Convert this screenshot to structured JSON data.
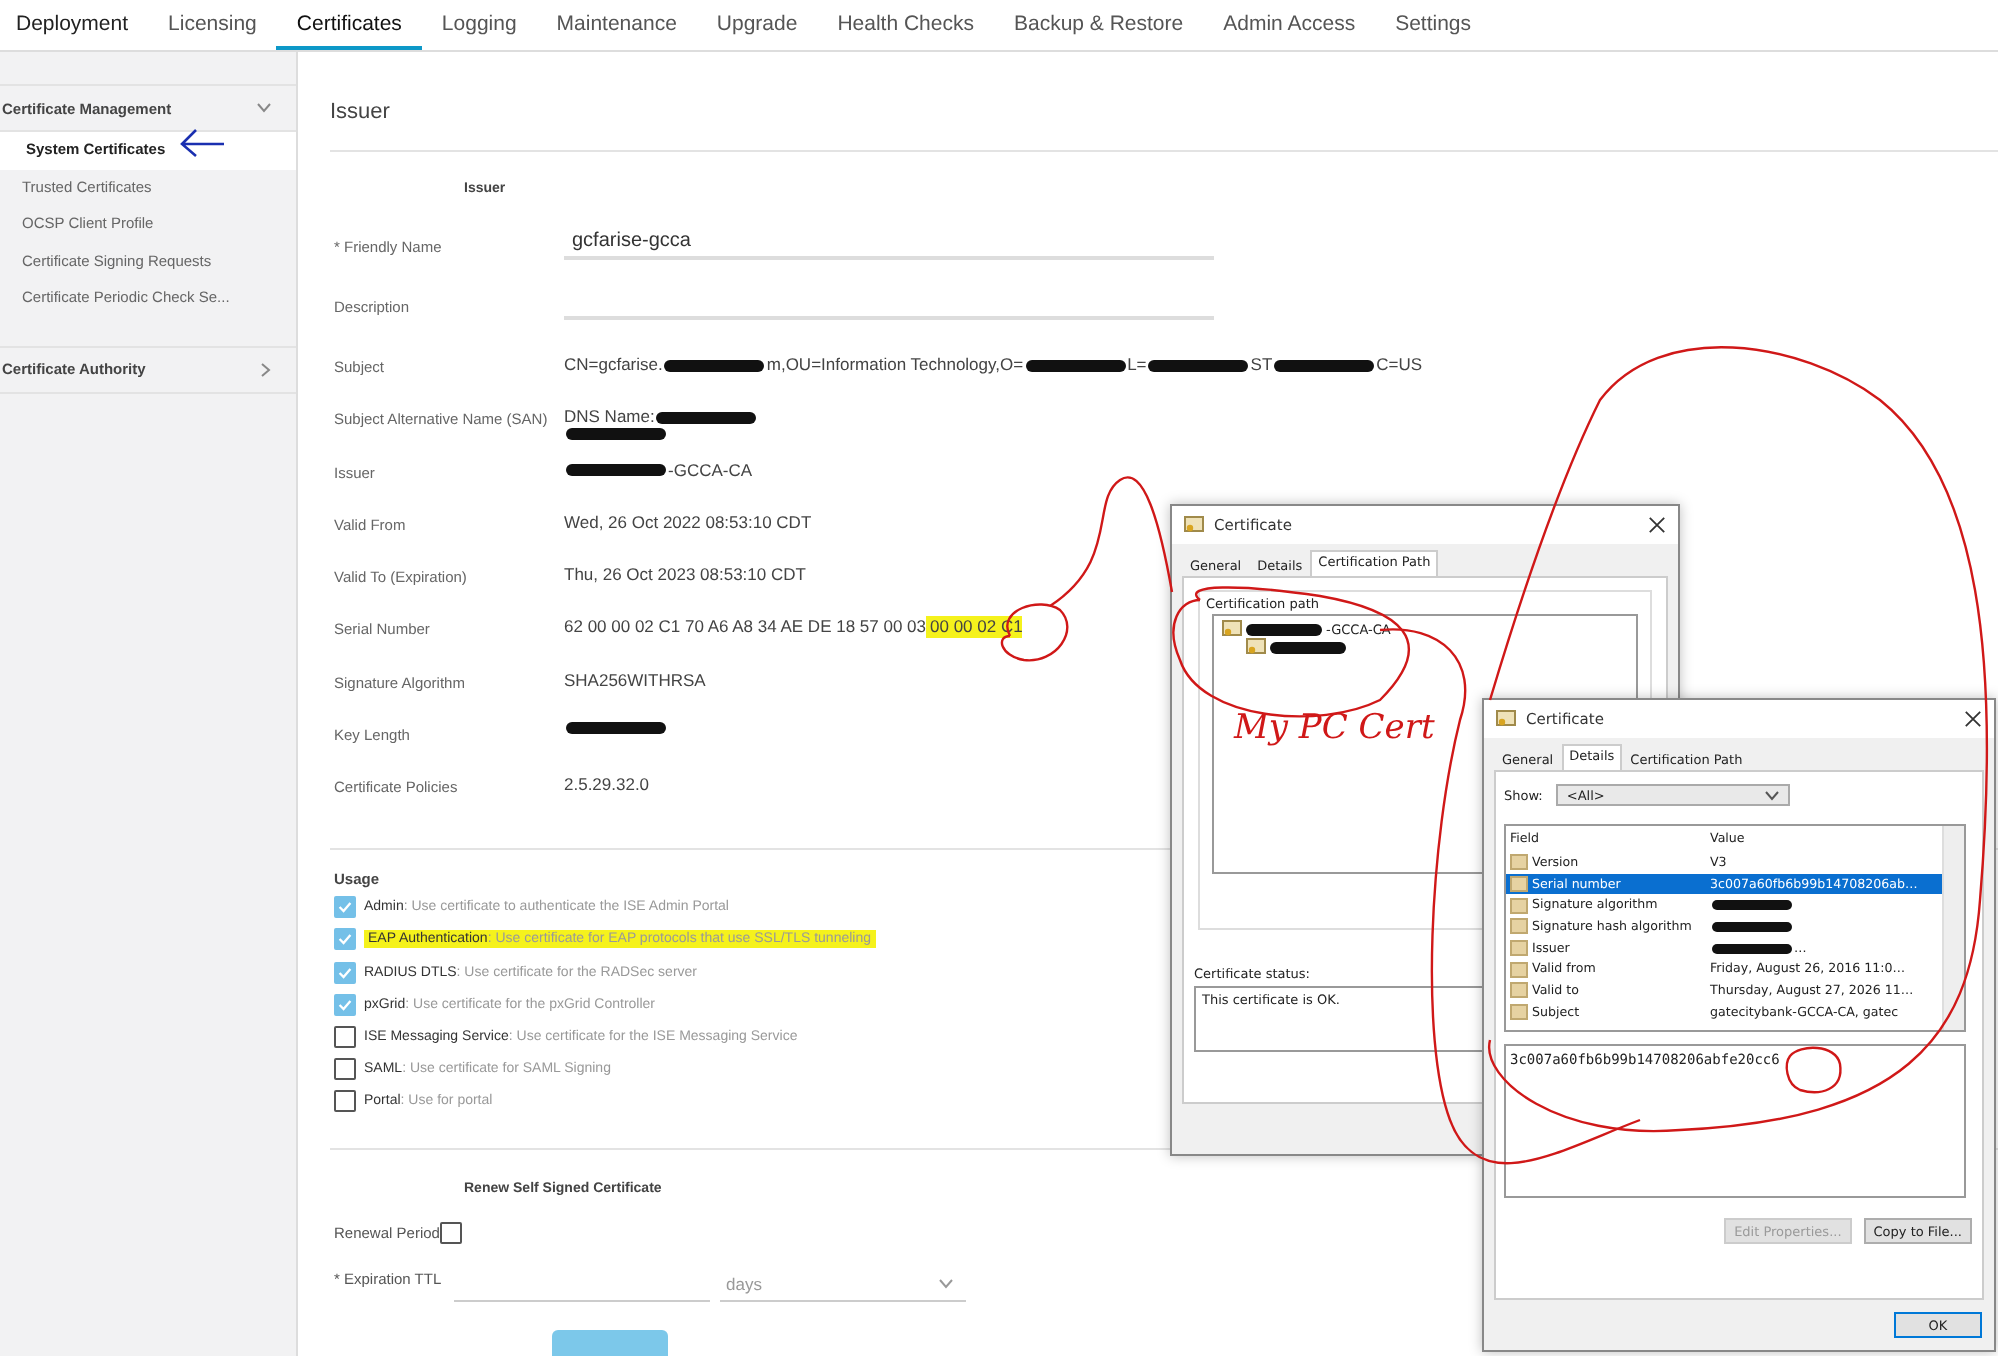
{
  "tabs": [
    {
      "label": "Deployment",
      "selected": false
    },
    {
      "label": "Licensing",
      "selected": false
    },
    {
      "label": "Certificates",
      "selected": true
    },
    {
      "label": "Logging",
      "selected": false
    },
    {
      "label": "Maintenance",
      "selected": false
    },
    {
      "label": "Upgrade",
      "selected": false
    },
    {
      "label": "Health Checks",
      "selected": false
    },
    {
      "label": "Backup & Restore",
      "selected": false
    },
    {
      "label": "Admin Access",
      "selected": false
    },
    {
      "label": "Settings",
      "selected": false
    }
  ],
  "sidebar": {
    "sections": [
      {
        "title": "Certificate Management",
        "expanded": true,
        "items": [
          {
            "label": "System Certificates",
            "selected": true
          },
          {
            "label": "Trusted Certificates",
            "selected": false
          },
          {
            "label": "OCSP Client Profile",
            "selected": false
          },
          {
            "label": "Certificate Signing Requests",
            "selected": false
          },
          {
            "label": "Certificate Periodic Check Se...",
            "selected": false
          }
        ]
      },
      {
        "title": "Certificate Authority",
        "expanded": false
      }
    ]
  },
  "page_title": "Issuer",
  "form": {
    "section_title": "Issuer",
    "fields": [
      {
        "kind": "input",
        "label": "* Friendly Name",
        "value": "gcfarise-gcca"
      },
      {
        "kind": "input",
        "label": "Description"
      },
      {
        "kind": "text",
        "label": "Subject",
        "segments": [
          {
            "kind": "text",
            "text": "CN=gcfarise."
          },
          {
            "kind": "redacted"
          },
          {
            "kind": "text",
            "text": "m,OU=Information Technology,O="
          },
          {
            "kind": "redacted"
          },
          {
            "kind": "text",
            "text": "L="
          },
          {
            "kind": "redacted"
          },
          {
            "kind": "text",
            "text": "ST"
          },
          {
            "kind": "redacted"
          },
          {
            "kind": "text",
            "text": "C=US"
          }
        ]
      },
      {
        "kind": "text",
        "label": "Subject Alternative Name (SAN)",
        "segments": [
          {
            "kind": "text",
            "text": "DNS Name:"
          },
          {
            "kind": "redacted"
          },
          {
            "kind": "break"
          },
          {
            "kind": "redacted"
          }
        ]
      },
      {
        "kind": "text",
        "label": "Issuer",
        "segments": [
          {
            "kind": "redacted"
          },
          {
            "kind": "text",
            "text": "-GCCA-CA"
          }
        ]
      },
      {
        "kind": "text",
        "label": "Valid From",
        "segments": [
          {
            "kind": "text",
            "text": "Wed, 26 Oct 2022 08:53:10 CDT"
          }
        ]
      },
      {
        "kind": "text",
        "label": "Valid To (Expiration)",
        "segments": [
          {
            "kind": "text",
            "text": "Thu, 26 Oct 2023 08:53:10 CDT"
          }
        ]
      },
      {
        "kind": "text",
        "label": "Serial Number",
        "segments": [
          {
            "kind": "text",
            "text": "62 00 00 02 C1 70 A6 A8 34 AE DE 18 57 00 03"
          },
          {
            "kind": "highlight",
            "text": "00 00 02 C1"
          }
        ]
      },
      {
        "kind": "text",
        "label": "Signature Algorithm",
        "segments": [
          {
            "kind": "text",
            "text": "SHA256WITHRSA"
          }
        ]
      },
      {
        "kind": "text",
        "label": "Key Length",
        "segments": [
          {
            "kind": "redacted"
          }
        ]
      },
      {
        "kind": "text",
        "label": "Certificate Policies",
        "segments": [
          {
            "kind": "text",
            "text": "2.5.29.32.0"
          }
        ]
      }
    ]
  },
  "usage": {
    "title": "Usage",
    "items": [
      {
        "name": "Admin",
        "description": ": Use certificate to authenticate the ISE Admin Portal",
        "checked": true,
        "highlighted": false
      },
      {
        "name": "EAP Authentication",
        "description": ": Use certificate for EAP protocols that use SSL/TLS tunneling",
        "checked": true,
        "highlighted": true
      },
      {
        "name": "RADIUS DTLS",
        "description": ": Use certificate for the RADSec server",
        "checked": true,
        "highlighted": false
      },
      {
        "name": "pxGrid",
        "description": ": Use certificate for the pxGrid Controller",
        "checked": true,
        "highlighted": false
      },
      {
        "name": "ISE Messaging Service",
        "description": ": Use certificate for the ISE Messaging Service",
        "checked": false,
        "highlighted": false
      },
      {
        "name": "SAML",
        "description": ": Use certificate for SAML Signing",
        "checked": false,
        "highlighted": false
      },
      {
        "name": "Portal",
        "description": ": Use for portal",
        "checked": false,
        "highlighted": false
      }
    ]
  },
  "renew": {
    "title": "Renew Self Signed Certificate",
    "renewal_period": {
      "label": "Renewal Period",
      "checked": false
    },
    "expiration_ttl": {
      "label": "* Expiration TTL",
      "unit": "days"
    }
  },
  "dialogs": [
    {
      "kind": "path",
      "title": "Certificate",
      "tabs": [
        {
          "label": "General",
          "selected": false
        },
        {
          "label": "Details",
          "selected": false
        },
        {
          "label": "Certification Path",
          "selected": true
        }
      ],
      "group_label": "Certification path",
      "tree": [
        {
          "segments": [
            {
              "kind": "redacted"
            },
            {
              "kind": "text",
              "text": "-GCCA-CA"
            }
          ],
          "children": [
            {
              "segments": [
                {
                  "kind": "redacted"
                }
              ]
            }
          ]
        }
      ],
      "status_label": "Certificate status:",
      "status": "This certificate is OK.",
      "note": "My PC Cert"
    },
    {
      "kind": "details",
      "title": "Certificate",
      "tabs": [
        {
          "label": "General",
          "selected": false
        },
        {
          "label": "Details",
          "selected": true
        },
        {
          "label": "Certification Path",
          "selected": false
        }
      ],
      "show_label": "Show:",
      "show_value": "<All>",
      "columns": [
        "Field",
        "Value"
      ],
      "rows": [
        {
          "field": "Version",
          "segments": [
            {
              "kind": "text",
              "text": "V3"
            }
          ],
          "selected": false
        },
        {
          "field": "Serial number",
          "segments": [
            {
              "kind": "text",
              "text": "3c007a60fb6b99b14708206ab…"
            }
          ],
          "selected": true
        },
        {
          "field": "Signature algorithm",
          "segments": [
            {
              "kind": "redacted"
            }
          ],
          "selected": false
        },
        {
          "field": "Signature hash algorithm",
          "segments": [
            {
              "kind": "redacted"
            }
          ],
          "selected": false
        },
        {
          "field": "Issuer",
          "segments": [
            {
              "kind": "redacted"
            },
            {
              "kind": "text",
              "text": "…"
            }
          ],
          "selected": false
        },
        {
          "field": "Valid from",
          "segments": [
            {
              "kind": "text",
              "text": "Friday, August 26, 2016 11:0…"
            }
          ],
          "selected": false
        },
        {
          "field": "Valid to",
          "segments": [
            {
              "kind": "text",
              "text": "Thursday, August 27, 2026 11…"
            }
          ],
          "selected": false
        },
        {
          "field": "Subject",
          "segments": [
            {
              "kind": "text",
              "text": "gatecitybank-GCCA-CA, gatec"
            }
          ],
          "selected": false
        }
      ],
      "detail_value": "3c007a60fb6b99b14708206abfe20cc6",
      "buttons": [
        {
          "label": "Edit Properties...",
          "disabled": true
        },
        {
          "label": "Copy to File...",
          "disabled": false
        },
        {
          "label": "OK",
          "disabled": false
        }
      ]
    }
  ]
}
